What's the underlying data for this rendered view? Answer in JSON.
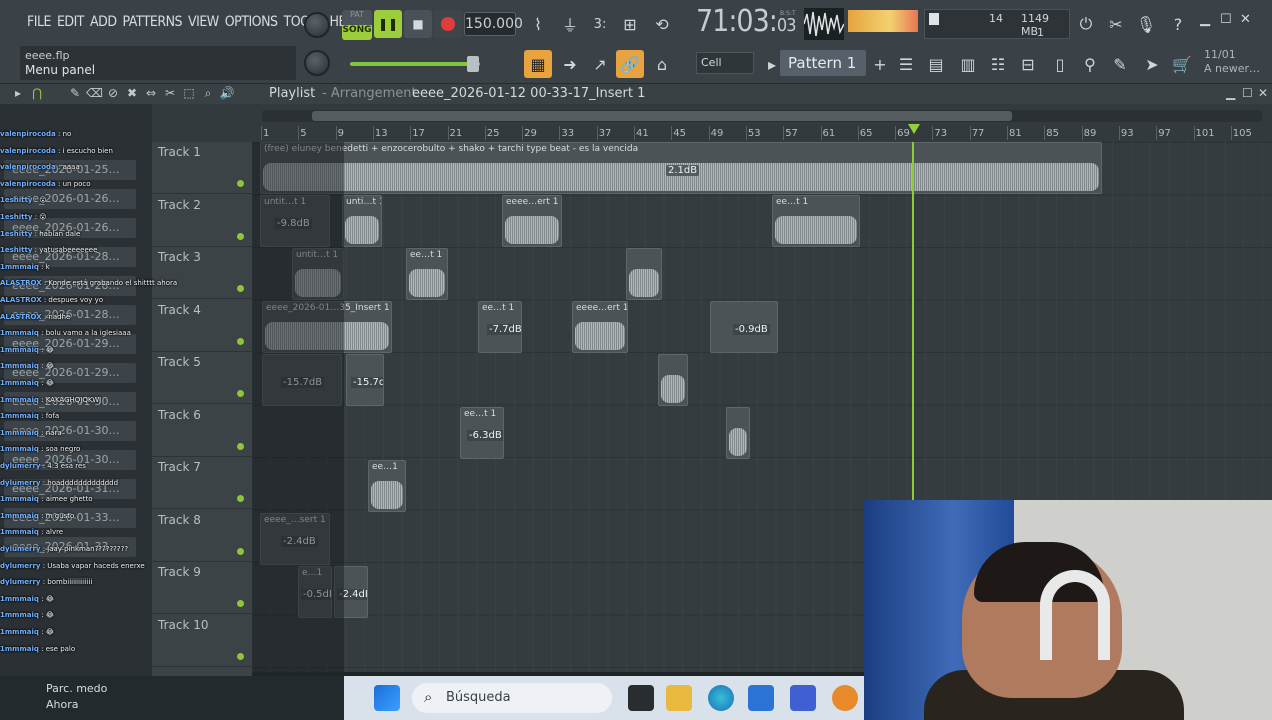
{
  "menu": [
    "FILE",
    "EDIT",
    "ADD",
    "PATTERNS",
    "VIEW",
    "OPTIONS",
    "TOOLS",
    "HELP"
  ],
  "hint": {
    "file": "eeee.flp",
    "text": "Menu panel"
  },
  "transport": {
    "pat": "PAT",
    "song": "SONG",
    "tempo": "150.000"
  },
  "time": {
    "main": "71:03",
    "sub": "03",
    "label": "B:S:T"
  },
  "cpu": {
    "voices": "14",
    "mem": "1149 MB",
    "cores": "1"
  },
  "pattern": {
    "name": "Pattern 1",
    "snap": "Cell"
  },
  "notify": {
    "date": "11/01",
    "text": "A newer…"
  },
  "playlist": {
    "title": "Playlist",
    "sep": "- Arrangement",
    "project": "eeee_2026-01-12 00-33-17_Insert 1"
  },
  "ruler": [
    "1",
    "5",
    "9",
    "13",
    "17",
    "21",
    "25",
    "29",
    "33",
    "37",
    "41",
    "45",
    "49",
    "53",
    "57",
    "61",
    "65",
    "69",
    "73",
    "77",
    "81",
    "85",
    "89",
    "93",
    "97",
    "101",
    "105"
  ],
  "tracks": [
    "Track 1",
    "Track 2",
    "Track 3",
    "Track 4",
    "Track 5",
    "Track 6",
    "Track 7",
    "Track 8",
    "Track 9",
    "Track 10"
  ],
  "browser": [
    "eeee_2026-01-25…",
    "eeee_2026-01-26…",
    "eeee_2026-01-26…",
    "eeee_2026-01-28…",
    "eeee_2026-01-28…",
    "eeee_2026-01-28…",
    "eeee_2026-01-29…",
    "eeee_2026-01-29…",
    "eeee_2026-01-30…",
    "eeee_2026-01-30…",
    "eeee_2026-01-30…",
    "eeee_2026-01-31…",
    "eeee_2026-01-33…",
    "eeee_2026-01-33…"
  ],
  "clips": {
    "t1": "(free) eluney benedetti + enzocerobulto + shako + tarchi type beat - es la vencida",
    "t1db": "2.1dB",
    "t2a": "untit…t 1",
    "t2db": "-9.8dB",
    "t2b": "unti…t 1",
    "t2c": "eeee…ert 1",
    "t2d": "ee…t 1",
    "t3a": "untit…t 1",
    "t3b": "ee…t 1",
    "t4a": "eeee_2026-01…35_Insert 1",
    "t4b": "ee…t 1",
    "t4db": "-7.7dB",
    "t4c": "eeee…ert 1",
    "t4db2": "-0.9dB",
    "t5a": "-15.7dB",
    "t5b": "-15.7dB",
    "t6a": "ee…t 1",
    "t6db": "-6.3dB",
    "t7a": "ee…1",
    "t8a": "eeee_…sert 1",
    "t8db": "-2.4dB",
    "t9a": "e…1",
    "t9db": "-0.5dB",
    "t9db2": "-2.4dB"
  },
  "chat": [
    {
      "u": "valenpirocoda",
      "m": "no"
    },
    {
      "u": "valenpirocoda",
      "m": "i escucho bien"
    },
    {
      "u": "valenpirocoda",
      "m": "aaaa"
    },
    {
      "u": "valenpirocoda",
      "m": "un poco"
    },
    {
      "u": "1eshitty",
      "m": "😮"
    },
    {
      "u": "1eshitty",
      "m": "😮"
    },
    {
      "u": "1eshitty",
      "m": "hablan dale"
    },
    {
      "u": "1eshitty",
      "m": "yatusabeeeeeee"
    },
    {
      "u": "1mmmaiq",
      "m": "k"
    },
    {
      "u": "ALASTROX",
      "m": "Konde está grabando el shitttt ahora"
    },
    {
      "u": "ALASTROX",
      "m": "despues voy yo"
    },
    {
      "u": "ALASTROX",
      "m": "nadhe"
    },
    {
      "u": "1mmmaiq",
      "m": "bolu vamo a la iglesiaaa"
    },
    {
      "u": "1mmmaiq",
      "m": "😂"
    },
    {
      "u": "1mmmaiq",
      "m": "😂"
    },
    {
      "u": "1mmmaiq",
      "m": "😂"
    },
    {
      "u": "1mmmaiq",
      "m": "KAKAGHQJQKWJ"
    },
    {
      "u": "1mmmaiq",
      "m": "fofa"
    },
    {
      "u": "1mmmaiq",
      "m": "nara"
    },
    {
      "u": "1mmmaiq",
      "m": "soa negro"
    },
    {
      "u": "dylumerry",
      "m": "4:3 esa res"
    },
    {
      "u": "dylumerry",
      "m": "hoaddddddddddddd"
    },
    {
      "u": "1mmmaiq",
      "m": "aimee ghetto"
    },
    {
      "u": "1mmmaiq",
      "m": "m gusto"
    },
    {
      "u": "1mmmaiq",
      "m": "alvre"
    },
    {
      "u": "dylumerry",
      "m": "jaay pinkman?????????"
    },
    {
      "u": "dylumerry",
      "m": "Usaba vapar haceds enerxe"
    },
    {
      "u": "dylumerry",
      "m": "bombiiiiiiiiiiiii"
    },
    {
      "u": "1mmmaiq",
      "m": "😂"
    },
    {
      "u": "1mmmaiq",
      "m": "😂"
    },
    {
      "u": "1mmmaiq",
      "m": "😂"
    },
    {
      "u": "1mmmaiq",
      "m": "ese palo"
    }
  ],
  "taskbar": {
    "search": "Búsqueda",
    "weather1": "Parc. medo",
    "weather2": "Ahora"
  },
  "colors": {
    "accent": "#9ccd3b",
    "record": "#e23b3b",
    "bg": "#1f2427"
  }
}
